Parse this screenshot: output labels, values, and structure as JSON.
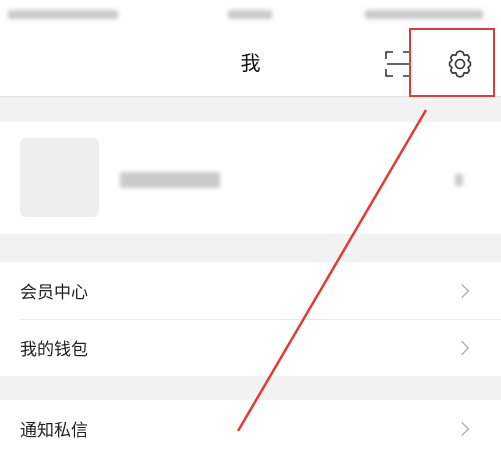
{
  "header": {
    "title": "我"
  },
  "menu": {
    "group1": [
      {
        "label": "会员中心"
      },
      {
        "label": "我的钱包"
      }
    ],
    "group2": [
      {
        "label": "通知私信"
      }
    ]
  },
  "colors": {
    "annotation": "#e53935"
  },
  "icons": [
    "scan-icon",
    "gear-icon",
    "chevron-right-icon"
  ]
}
